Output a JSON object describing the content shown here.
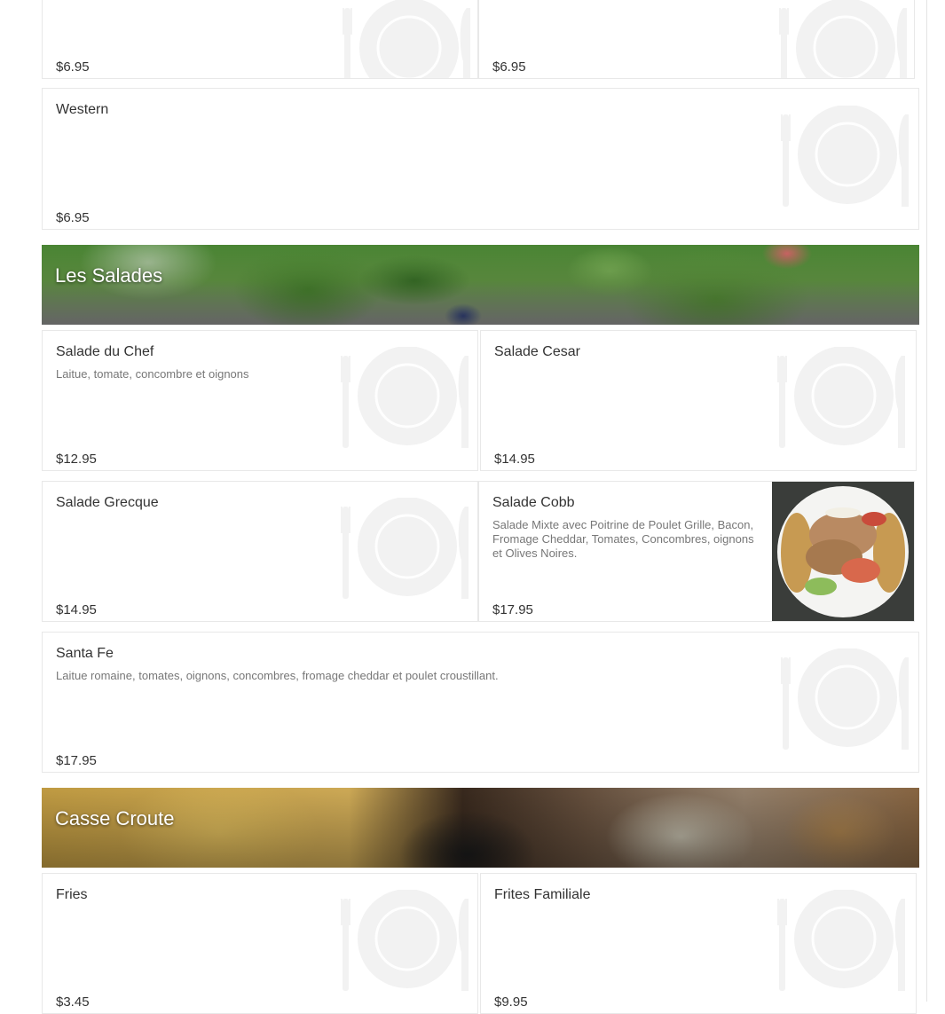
{
  "top_row": [
    {
      "price": "$6.95"
    },
    {
      "price": "$6.95"
    }
  ],
  "western": {
    "name": "Western",
    "price": "$6.95"
  },
  "sections": [
    {
      "title": "Les Salades",
      "items": [
        {
          "name": "Salade du Chef",
          "description": "Laitue, tomate, concombre et oignons",
          "price": "$12.95"
        },
        {
          "name": "Salade Cesar",
          "description": "",
          "price": "$14.95"
        },
        {
          "name": "Salade Grecque",
          "description": "",
          "price": "$14.95"
        },
        {
          "name": "Salade Cobb",
          "description": "Salade Mixte avec Poitrine de Poulet Grille, Bacon, Fromage Cheddar, Tomates, Concombres, oignons et Olives Noires.",
          "price": "$17.95",
          "has_photo": true
        },
        {
          "name": "Santa Fe",
          "description": "Laitue romaine, tomates, oignons, concombres, fromage cheddar et poulet croustillant.",
          "price": "$17.95"
        }
      ]
    },
    {
      "title": "Casse Croute",
      "items": [
        {
          "name": "Fries",
          "description": "",
          "price": "$3.45"
        },
        {
          "name": "Frites Familiale",
          "description": "",
          "price": "$9.95"
        }
      ]
    }
  ],
  "icons": {
    "placeholder": "plate-cutlery-icon"
  },
  "colors": {
    "border": "#e8e8e8",
    "text": "#333333",
    "muted": "#777777",
    "placeholder": "#f2f2f2"
  }
}
